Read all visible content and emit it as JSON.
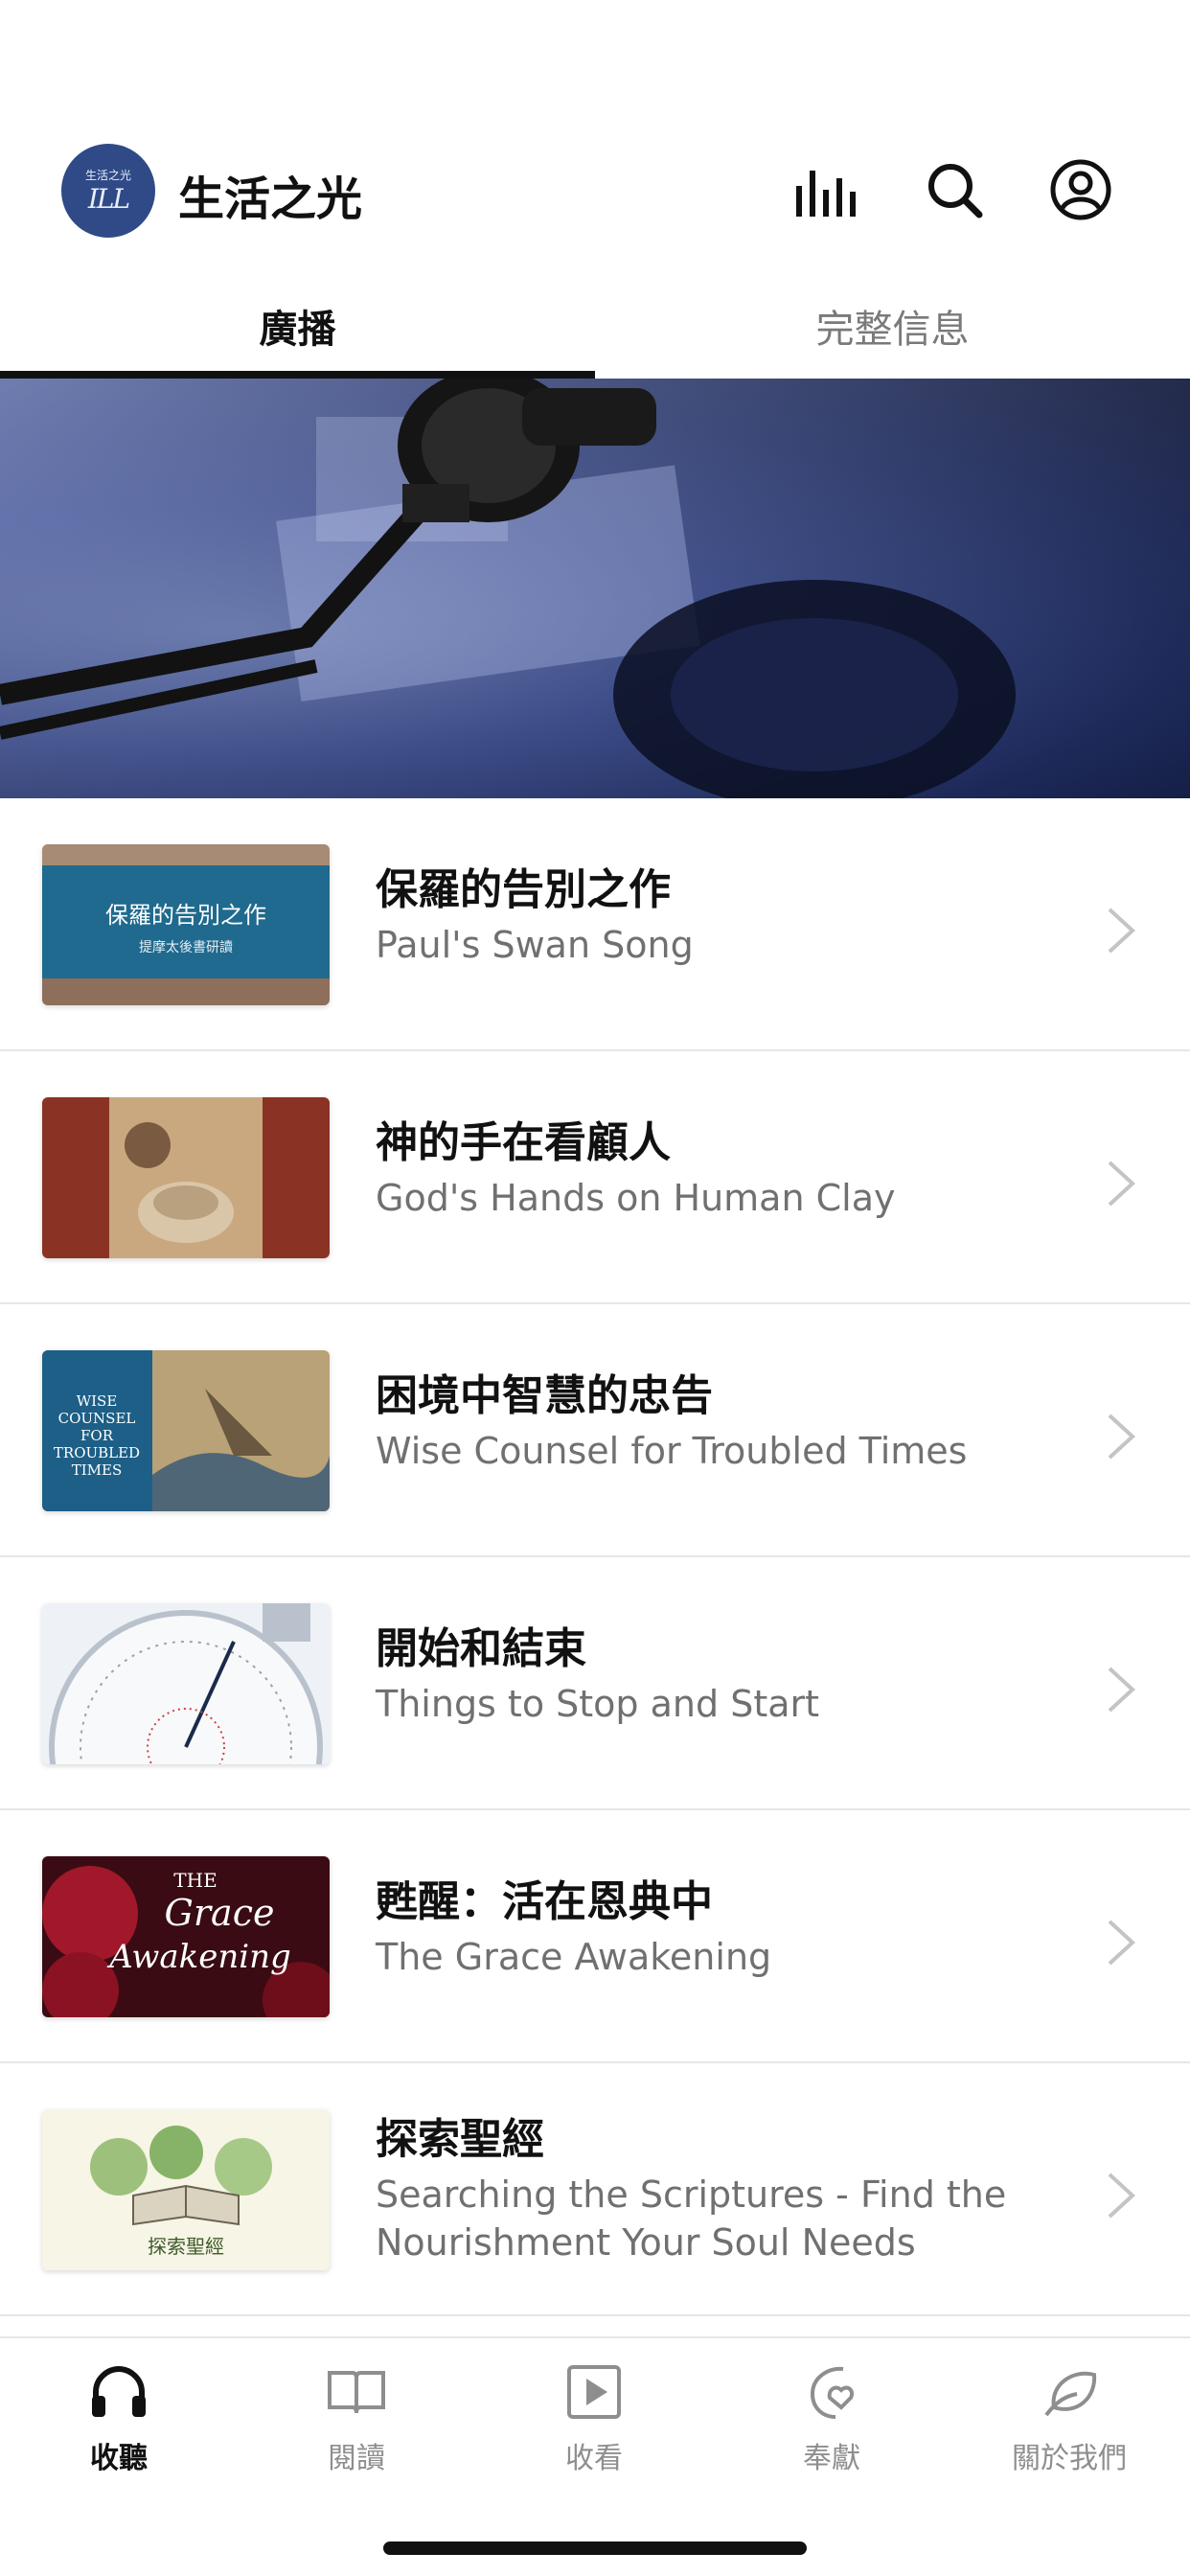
{
  "app": {
    "title": "生活之光",
    "logo_text": "生活之光",
    "logo_monogram": "ILL"
  },
  "header_icons": [
    "equalizer-icon",
    "search-icon",
    "profile-icon"
  ],
  "tabs": [
    {
      "label": "廣播",
      "active": true
    },
    {
      "label": "完整信息",
      "active": false
    }
  ],
  "programs": [
    {
      "title": "保羅的告別之作",
      "subtitle": "Paul's Swan Song",
      "thumb_text": "保羅的告別之作",
      "thumb_subtext": "提摩太後書研讀"
    },
    {
      "title": "神的手在看顧人",
      "subtitle": "God's Hands on Human Clay"
    },
    {
      "title": "困境中智慧的忠告",
      "subtitle": "Wise Counsel for Troubled Times",
      "thumb_lines": [
        "WISE",
        "COUNSEL",
        "FOR",
        "TROUBLED",
        "TIMES"
      ]
    },
    {
      "title": "開始和結束",
      "subtitle": "Things to Stop and Start"
    },
    {
      "title": "甦醒：活在恩典中",
      "subtitle": "The Grace Awakening",
      "thumb_line1": "THE",
      "thumb_line2": "Grace",
      "thumb_line3": "Awakening"
    },
    {
      "title": "探索聖經",
      "subtitle": "Searching the Scriptures - Find the Nourishment Your Soul Needs",
      "thumb_text": "探索聖經"
    }
  ],
  "bottom_tabs": [
    {
      "label": "收聽",
      "icon": "headphones-icon",
      "active": true
    },
    {
      "label": "閱讀",
      "icon": "book-icon",
      "active": false
    },
    {
      "label": "收看",
      "icon": "play-icon",
      "active": false
    },
    {
      "label": "奉獻",
      "icon": "hand-heart-icon",
      "active": false
    },
    {
      "label": "關於我們",
      "icon": "leaf-icon",
      "active": false
    }
  ],
  "colors": {
    "accent": "#111111",
    "inactive": "#8e8e8e",
    "logo_bg": "#2f4a86"
  }
}
